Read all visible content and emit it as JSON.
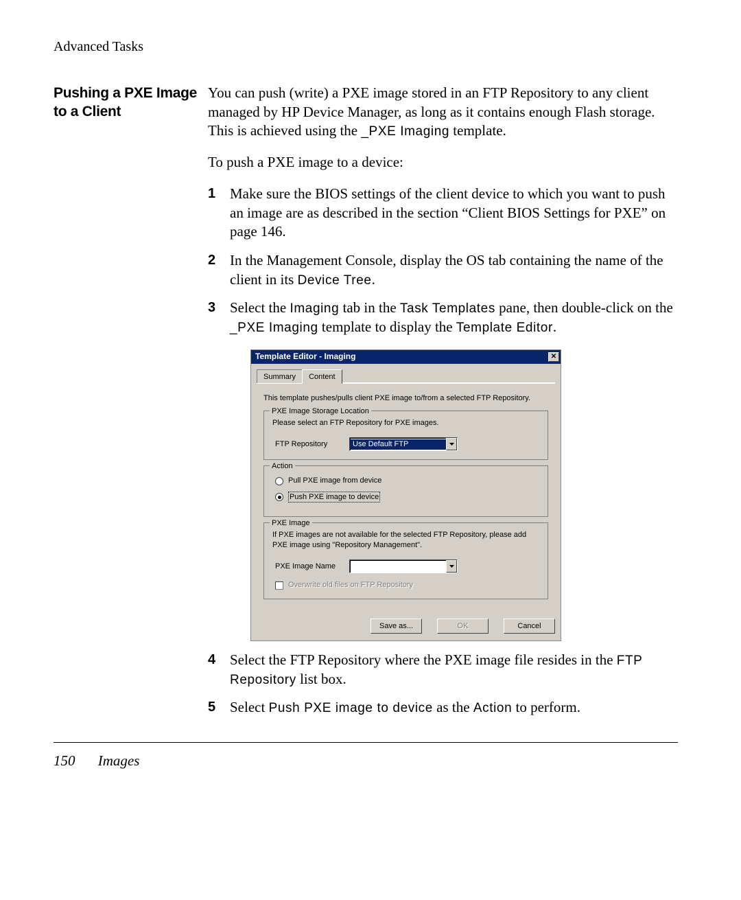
{
  "header": "Advanced Tasks",
  "sideHeading": "Pushing a PXE Image to a Client",
  "intro": {
    "part1": "You can push (write) a PXE image stored in an FTP Repository to any client managed by HP Device Manager, as long as it contains enough Flash storage. This is achieved using the ",
    "code1": "_PXE Imaging",
    "part2": " template."
  },
  "lead": "To push a PXE image to a device:",
  "steps": {
    "n1": "1",
    "s1": "Make sure the BIOS settings of the client device to which you want to push an image are as described in the section “Client BIOS Settings for PXE” on page 146.",
    "n2": "2",
    "s2a": "In the Management Console, display the OS tab containing the name of the client in its ",
    "s2b": "Device Tree",
    "s2c": ".",
    "n3": "3",
    "s3a": "Select the ",
    "s3b": "Imaging",
    "s3c": " tab in the ",
    "s3d": "Task Templates",
    "s3e": " pane, then double-click on the ",
    "s3f": "_PXE Imaging",
    "s3g": " template to display the ",
    "s3h": "Template Editor",
    "s3i": ".",
    "n4": "4",
    "s4a": "Select the FTP Repository where the PXE image file resides in the ",
    "s4b": "FTP Repository",
    "s4c": " list box.",
    "n5": "5",
    "s5a": "Select ",
    "s5b": "Push PXE image to device",
    "s5c": " as the ",
    "s5d": "Action",
    "s5e": " to perform."
  },
  "dialog": {
    "title": "Template Editor - Imaging",
    "tabs": {
      "summary": "Summary",
      "content": "Content"
    },
    "desc": "This template pushes/pulls client PXE image to/from a selected FTP Repository.",
    "group1": {
      "legend": "PXE Image Storage Location",
      "text": "Please select an FTP Repository for PXE images.",
      "label": "FTP Repository",
      "value": "Use Default FTP"
    },
    "group2": {
      "legend": "Action",
      "opt1": "Pull PXE image from device",
      "opt2": "Push PXE image to device"
    },
    "group3": {
      "legend": "PXE Image",
      "text": "If PXE images are not available for the selected FTP Repository, please add PXE image using \"Repository Management\".",
      "label": "PXE Image Name",
      "checkbox": "Overwrite old files on FTP Repository"
    },
    "buttons": {
      "saveas": "Save as...",
      "ok": "OK",
      "cancel": "Cancel"
    }
  },
  "footer": {
    "pageNum": "150",
    "section": "Images"
  }
}
